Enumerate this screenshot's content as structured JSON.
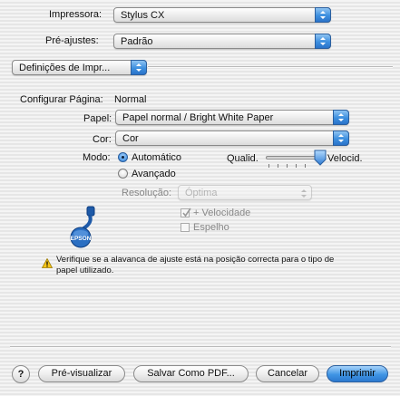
{
  "printer": {
    "label": "Impressora:",
    "value": "Stylus CX"
  },
  "presets": {
    "label": "Pré-ajustes:",
    "value": "Padrão"
  },
  "panel": {
    "value": "Definições de Impr..."
  },
  "page_setup": {
    "label": "Configurar Página:",
    "value": "Normal"
  },
  "paper": {
    "label": "Papel:",
    "value": "Papel normal / Bright White Paper"
  },
  "color": {
    "label": "Cor:",
    "value": "Cor"
  },
  "mode": {
    "label": "Modo:",
    "options": [
      "Automático",
      "Avançado"
    ],
    "selected": "Automático",
    "slider_left": "Qualid.",
    "slider_right": "Velocid.",
    "slider_level": 1.0
  },
  "resolution": {
    "label": "Resolução:",
    "value": "Óptima"
  },
  "speed_check": {
    "label": "+ Velocidade",
    "checked": true
  },
  "mirror_check": {
    "label": "Espelho",
    "checked": false
  },
  "logo": {
    "text": "EPSON"
  },
  "warning": {
    "text_line1": "Verifique se a alavanca de ajuste está na posição correcta para o tipo de",
    "text_line2": "papel utilizado."
  },
  "buttons": {
    "help": "?",
    "preview": "Pré-visualizar",
    "save_pdf": "Salvar Como PDF...",
    "cancel": "Cancelar",
    "print": "Imprimir"
  },
  "colors": {
    "accent": "#3d8fdf",
    "window_bg": "#ececec"
  }
}
